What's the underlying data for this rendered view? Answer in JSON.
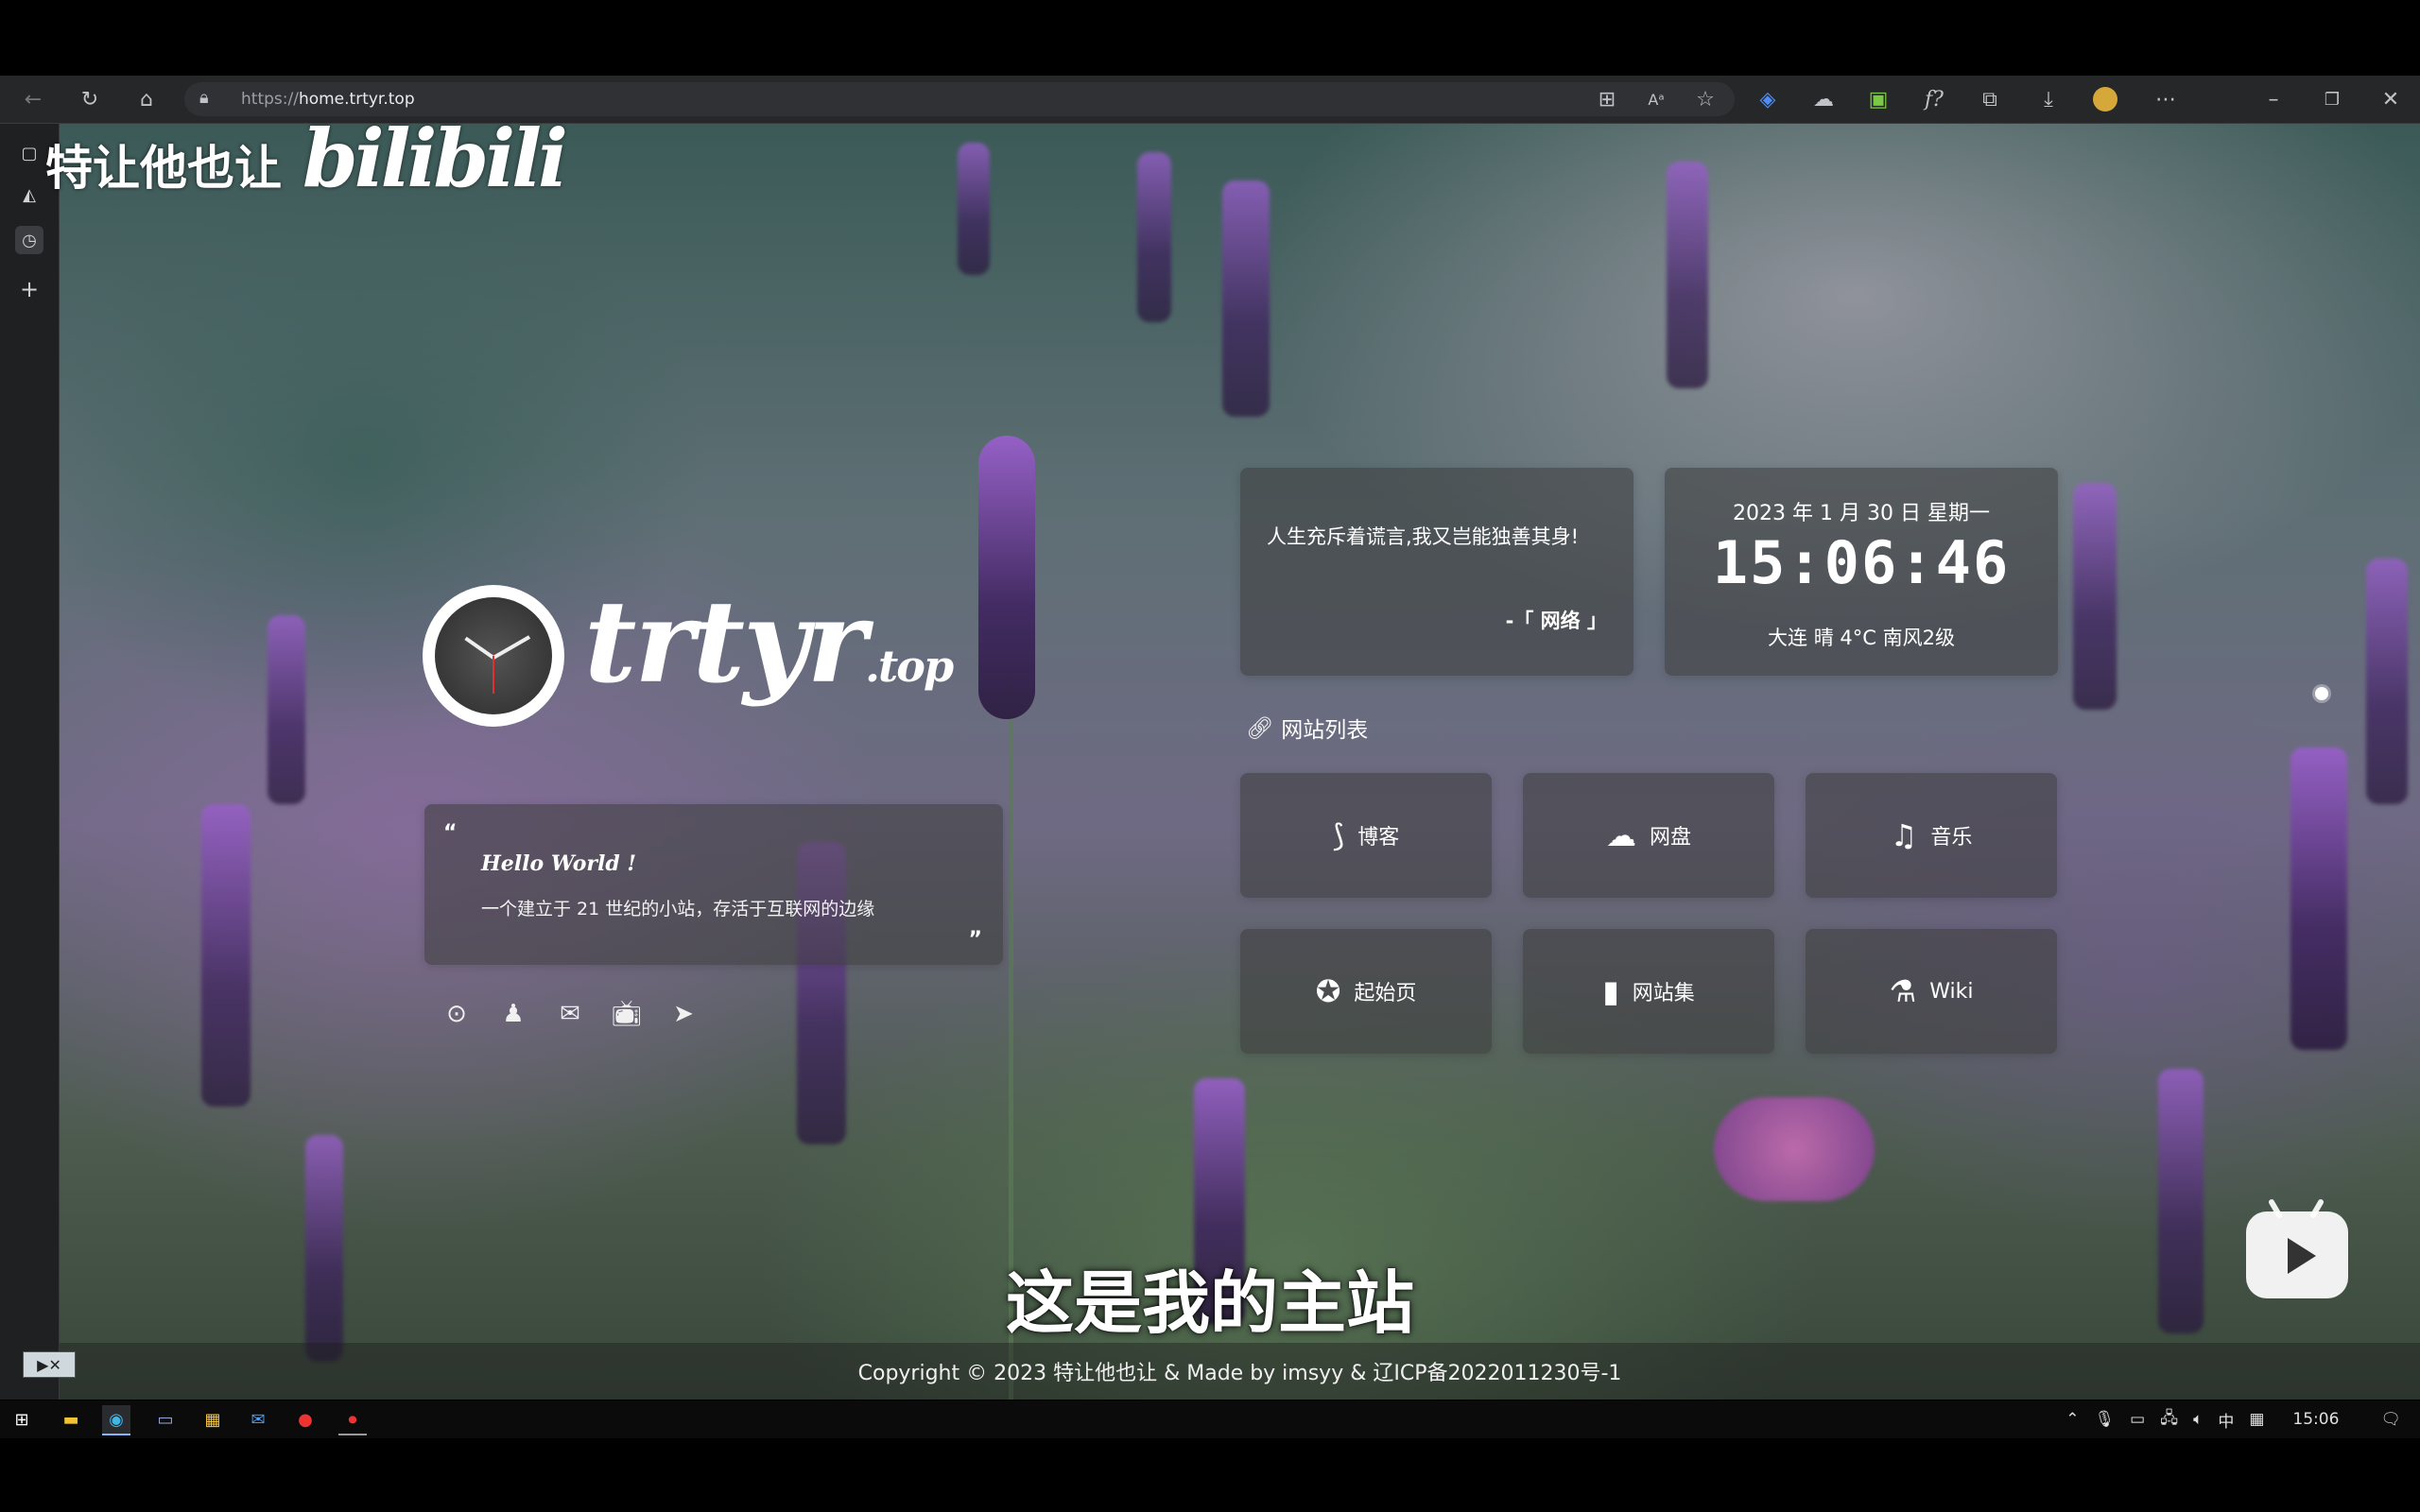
{
  "browser": {
    "url_scheme": "https://",
    "url_host": "home.trtyr.top",
    "icons": [
      "back-icon",
      "refresh-icon",
      "home-icon",
      "lock-icon",
      "tab-grid-icon",
      "read-aloud-icon",
      "favorite-add-icon",
      "extension-shield-icon",
      "cloud-icon",
      "ext-green-icon",
      "formula-icon",
      "extensions-icon",
      "download-icon",
      "profile-avatar-icon",
      "more-icon",
      "minimize-icon",
      "restore-icon",
      "close-icon"
    ]
  },
  "sidebar": {
    "icons": [
      "tabs-icon",
      "copilot-icon",
      "clock-ext-icon",
      "add-icon"
    ]
  },
  "logo": {
    "main": "trtyr",
    "sub": ".top"
  },
  "hello": {
    "open_quote": "“",
    "close_quote": "”",
    "title": "Hello World !",
    "description": "一个建立于 21 世纪的小站，存活于互联网的边缘"
  },
  "social": [
    "github-icon",
    "qq-icon",
    "email-icon",
    "bilibili-icon",
    "telegram-icon"
  ],
  "quote": {
    "text": "人生充斥着谎言,我又岂能独善其身!",
    "source": "-「 网络 」"
  },
  "time": {
    "date": "2023 年 1 月 30 日 星期一",
    "clock": "15:06:46",
    "weather": "大连  晴 4°C 南风2级"
  },
  "sites": {
    "heading": "网站列表",
    "items": [
      {
        "label": "博客",
        "icon": "blog-icon"
      },
      {
        "label": "网盘",
        "icon": "cloud-drive-icon"
      },
      {
        "label": "音乐",
        "icon": "music-icon"
      },
      {
        "label": "起始页",
        "icon": "compass-icon"
      },
      {
        "label": "网站集",
        "icon": "bookmark-icon"
      },
      {
        "label": "Wiki",
        "icon": "flask-icon"
      }
    ]
  },
  "footer": {
    "text": "Copyright © 2023 特让他也让 & Made by imsyy & 辽ICP备2022011230号-1"
  },
  "overlay": {
    "watermark_text": "特让他也让",
    "watermark_logo": "bilibili",
    "subtitle": "这是我的主站"
  },
  "taskbar": {
    "time": "15:06",
    "ime": "中"
  }
}
